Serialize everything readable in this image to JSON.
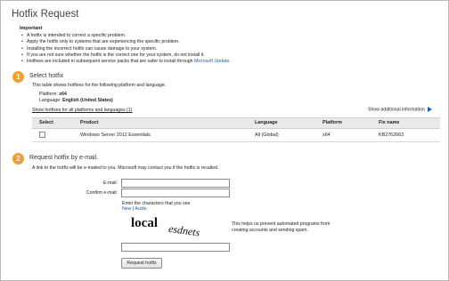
{
  "page": {
    "title": "Hotfix Request"
  },
  "important": {
    "heading": "Important",
    "bullets": [
      "A hotfix is intended to correct a specific problem.",
      "Apply the hotfix only to systems that are experiencing the specific problem.",
      "Installing the incorrect hotfix can cause damage to your system.",
      "If you are not sure whether the hotfix is the correct one for your system, do not install it."
    ],
    "last_bullet_prefix": "Hotfixes are included in subsequent service packs that are safer to install through ",
    "last_bullet_link": "Microsoft Update",
    "last_bullet_suffix": "."
  },
  "step1": {
    "number": "1",
    "title": "Select hotfix",
    "description": "This table shows hotfixes for the following platform and language.",
    "platform_label": "Platform:",
    "platform_value": "x64",
    "language_label": "Language:",
    "language_value": "English (United States)",
    "show_all_link": "Show hotfixes for all platforms and languages (1)",
    "show_additional_link": "Show additional information",
    "table": {
      "headers": [
        "Select",
        "Product",
        "Language",
        "Platform",
        "Fix name"
      ],
      "rows": [
        {
          "product": "Windows Server 2012 Essentials",
          "language": "All (Global)",
          "platform": "x64",
          "fix_name": "KB2762663"
        }
      ]
    }
  },
  "step2": {
    "number": "2",
    "title": "Request hotfix by e-mail.",
    "description": "A link to the hotfix will be e-mailed to you. Microsoft may contact you if the hotfix is recalled.",
    "email_label": "E-mail:",
    "confirm_email_label": "Confirm e-mail:",
    "captcha_prompt": "Enter the characters that you see",
    "captcha_new": "New",
    "captcha_separator": "|",
    "captcha_audio": "Audio",
    "captcha_word1": "local",
    "captcha_word2": "esdnets",
    "captcha_help_line1": "This helps us prevent automated programs from",
    "captcha_help_line2": "creating accounts and sending spam.",
    "submit_label": "Request hotfix"
  },
  "colors": {
    "accent": "#f0a030",
    "link": "#1a5fb4",
    "table_header": "#e9e9e9"
  }
}
